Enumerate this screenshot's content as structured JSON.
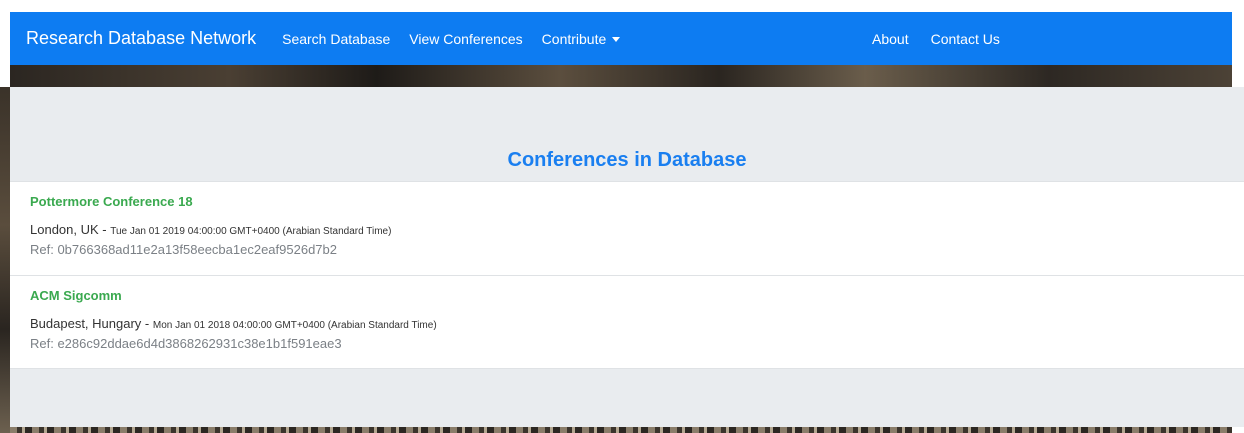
{
  "navbar": {
    "brand": "Research Database Network",
    "links": {
      "search": "Search Database",
      "conferences": "View Conferences",
      "contribute": "Contribute",
      "about": "About",
      "contact": "Contact Us"
    }
  },
  "page": {
    "title": "Conferences in Database"
  },
  "conferences": [
    {
      "name": "Pottermore Conference 18",
      "location": "London, UK",
      "separator": " - ",
      "date": "Tue Jan 01 2019 04:00:00 GMT+0400 (Arabian Standard Time)",
      "ref": "Ref: 0b766368ad11e2a13f58eecba1ec2eaf9526d7b2"
    },
    {
      "name": "ACM Sigcomm",
      "location": "Budapest, Hungary",
      "separator": " - ",
      "date": "Mon Jan 01 2018 04:00:00 GMT+0400 (Arabian Standard Time)",
      "ref": "Ref: e286c92ddae6d4d3868262931c38e1b1f591eae3"
    }
  ],
  "colors": {
    "navbar": "#0d7cf2",
    "title": "#1a7ff0",
    "conference_name": "#3aa94f",
    "ref": "#7b8086"
  },
  "icons": {
    "contribute_dropdown": "caret-down-icon"
  }
}
